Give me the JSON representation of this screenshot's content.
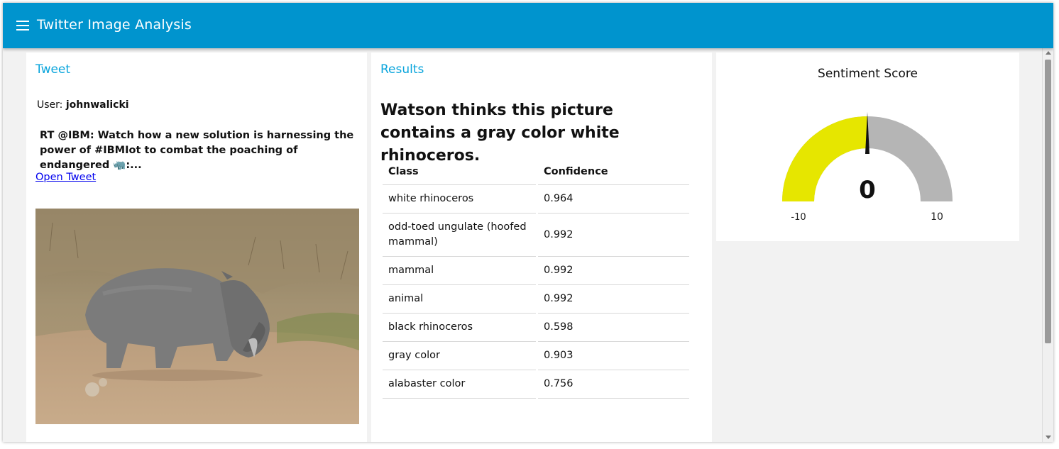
{
  "app": {
    "title": "Twitter Image Analysis"
  },
  "tweet_card": {
    "title": "Tweet",
    "user_label": "User:",
    "username": "johnwalicki",
    "text": "RT @IBM: Watch how a new solution is harnessing the power of #IBMIot to combat the poaching of endangered 🦏:...",
    "link_text": "Open Tweet",
    "image_subject": "white rhinoceros grazing on dry savanna"
  },
  "results_card": {
    "title": "Results",
    "headline": "Watson thinks this picture contains a gray color white rhinoceros.",
    "columns": [
      "Class",
      "Confidence"
    ],
    "rows": [
      [
        "white rhinoceros",
        "0.964"
      ],
      [
        "odd-toed ungulate (hoofed mammal)",
        "0.992"
      ],
      [
        "mammal",
        "0.992"
      ],
      [
        "animal",
        "0.992"
      ],
      [
        "black rhinoceros",
        "0.598"
      ],
      [
        "gray color",
        "0.903"
      ],
      [
        "alabaster color",
        "0.756"
      ]
    ]
  },
  "gauge_card": {
    "title": "Sentiment Score",
    "value": 0,
    "value_label": "0",
    "min": -10,
    "max": 10,
    "min_label": "-10",
    "max_label": "10",
    "fill_color": "#e6e600",
    "track_color": "#b5b5b5"
  },
  "colors": {
    "toolbar": "#0094ce",
    "card_title": "#0aa5dc",
    "link": "#0000ee"
  },
  "icons": {
    "menu": "hamburger-menu-icon"
  }
}
